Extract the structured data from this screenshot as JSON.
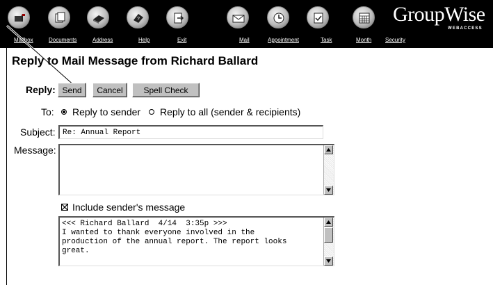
{
  "brand": {
    "name": "GroupWise",
    "sub": "WEBACCESS"
  },
  "toolbar_icons": [
    "mailbox-icon",
    "documents-icon",
    "address-book-icon",
    "help-icon",
    "exit-icon",
    "mail-icon",
    "appointment-icon",
    "task-icon",
    "month-calendar-icon"
  ],
  "nav": {
    "mailbox": "Mailbox",
    "documents": "Documents",
    "address": "Address",
    "help": "Help",
    "exit": "Exit",
    "mail": "Mail",
    "appointment": "Appointment",
    "task": "Task",
    "month": "Month",
    "security": "Security"
  },
  "page_title": "Reply to Mail Message from Richard Ballard",
  "reply": {
    "label": "Reply:",
    "send": "Send",
    "cancel": "Cancel",
    "spell_check": "Spell Check"
  },
  "to": {
    "label": "To:",
    "option_sender": "Reply to sender",
    "option_all": "Reply to all (sender & recipients)",
    "selected": "Reply to sender"
  },
  "subject": {
    "label": "Subject:",
    "value": "Re: Annual Report"
  },
  "message": {
    "label": "Message:",
    "value": ""
  },
  "include": {
    "label": "Include sender's message",
    "checked": true
  },
  "quoted": {
    "lines": [
      "<<< Richard Ballard  4/14  3:35p >>>",
      "I wanted to thank everyone involved in the",
      "production of the annual report. The report looks",
      "great."
    ]
  }
}
